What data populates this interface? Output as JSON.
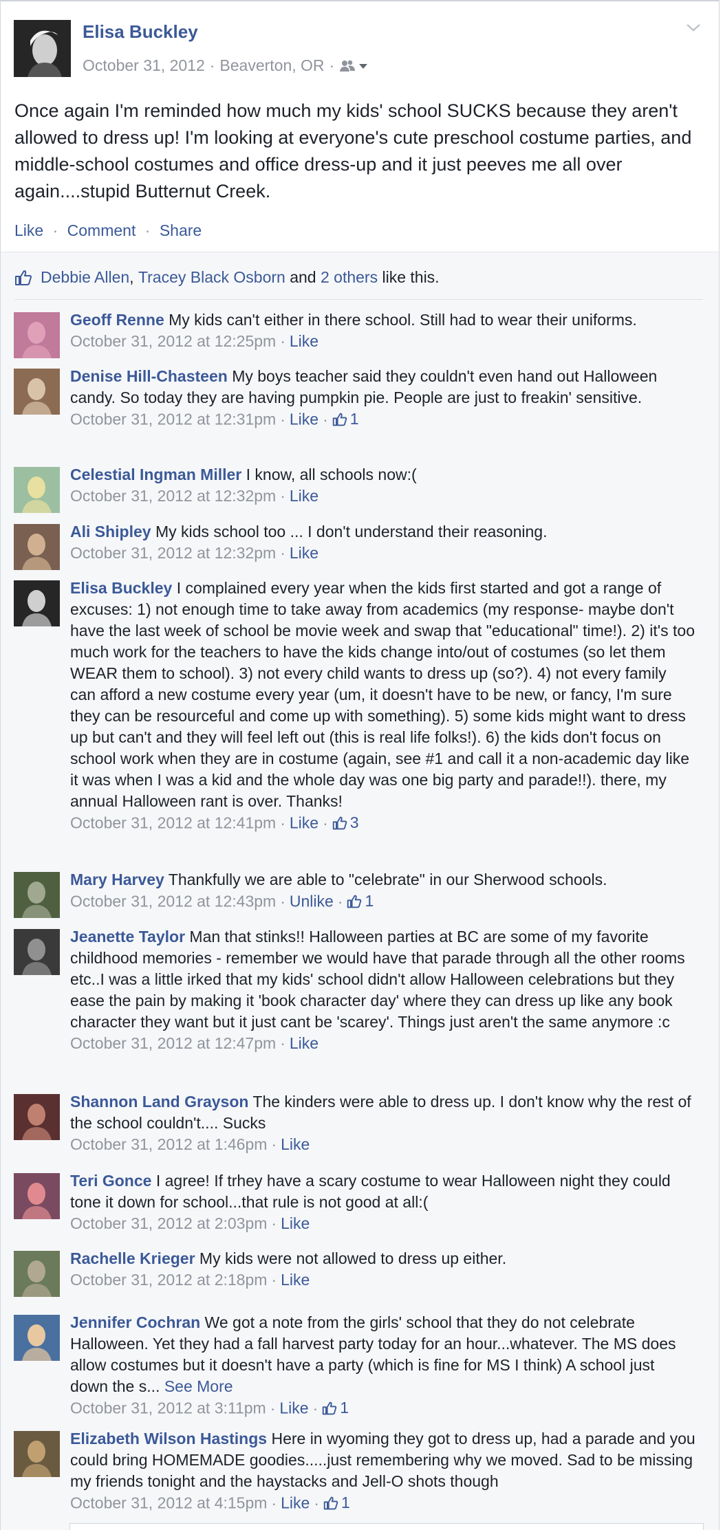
{
  "post": {
    "author": "Elisa Buckley",
    "date": "October 31, 2012",
    "location": "Beaverton, OR",
    "text": "Once again I'm reminded how much my kids' school SUCKS because they aren't allowed to dress up! I'm looking at everyone's cute preschool costume parties, and middle-school costumes and office dress-up and it just peeves me all over again....stupid Butternut Creek.",
    "actions": {
      "like": "Like",
      "comment": "Comment",
      "share": "Share"
    },
    "audience_icon": "friends-icon"
  },
  "likes": {
    "name1": "Debbie Allen",
    "name2": "Tracey Black Osborn",
    "and": "and",
    "others": "2 others",
    "suffix": "like this."
  },
  "comments": [
    {
      "name": "Geoff Renne",
      "text": "My kids can't either in there school. Still had to wear their uniforms.",
      "time": "October 31, 2012 at 12:25pm",
      "action": "Like",
      "likes": ""
    },
    {
      "name": "Denise Hill-Chasteen",
      "text": "My boys teacher said they couldn't even hand out Halloween candy. So today they are having pumpkin pie. People are just to freakin' sensitive.",
      "time": "October 31, 2012 at 12:31pm",
      "action": "Like",
      "likes": "1"
    },
    {
      "name": "Celestial Ingman Miller",
      "text": "I know, all schools now:(",
      "time": "October 31, 2012 at 12:32pm",
      "action": "Like",
      "likes": ""
    },
    {
      "name": "Ali Shipley",
      "text": "My kids school too ... I don't understand their reasoning.",
      "time": "October 31, 2012 at 12:32pm",
      "action": "Like",
      "likes": ""
    },
    {
      "name": "Elisa Buckley",
      "text": "I complained every year when the kids first started and got a range of excuses: 1) not enough time to take away from academics (my response- maybe don't have the last week of school be movie week and swap that \"educational\" time!). 2) it's too much work for the teachers to have the kids change into/out of costumes (so let them WEAR them to school). 3) not every child wants to dress up (so?). 4) not every family can afford a new costume every year (um, it doesn't have to be new, or fancy, I'm sure they can be resourceful and come up with something). 5) some kids might want to dress up but can't and they will feel left out (this is real life folks!). 6) the kids don't focus on school work when they are in costume (again, see #1 and call it a non-academic day like it was when I was a kid and the whole day was one big party and parade!!). there, my annual Halloween rant is over. Thanks!",
      "time": "October 31, 2012 at 12:41pm",
      "action": "Like",
      "likes": "3"
    },
    {
      "name": "Mary Harvey",
      "text": "Thankfully we are able to \"celebrate\" in our Sherwood schools.",
      "time": "October 31, 2012 at 12:43pm",
      "action": "Unlike",
      "likes": "1"
    },
    {
      "name": "Jeanette Taylor",
      "text": "Man that stinks!! Halloween parties at BC are some of my favorite childhood memories - remember we would have that parade through all the other rooms etc..I was a little irked that my kids' school didn't allow Halloween celebrations but they ease the pain by making it 'book character day' where they can dress up like any book character they want but it just cant be 'scarey'. Things just aren't the same anymore :c",
      "time": "October 31, 2012 at 12:47pm",
      "action": "Like",
      "likes": ""
    },
    {
      "name": "Shannon Land Grayson",
      "text": "The kinders were able to dress up. I don't know why the rest of the school couldn't.... Sucks",
      "time": "October 31, 2012 at 1:46pm",
      "action": "Like",
      "likes": ""
    },
    {
      "name": "Teri Gonce",
      "text": "I agree! If trhey have a scary costume to wear Halloween night they could tone it down for school...that rule is not good at all:(",
      "time": "October 31, 2012 at 2:03pm",
      "action": "Like",
      "likes": ""
    },
    {
      "name": "Rachelle Krieger",
      "text": "My kids were not allowed to dress up either.",
      "time": "October 31, 2012 at 2:18pm",
      "action": "Like",
      "likes": ""
    },
    {
      "name": "Jennifer Cochran",
      "text": "We got a note from the girls' school that they do not celebrate Halloween. Yet they had a fall harvest party today for an hour...whatever. The MS does allow costumes but it doesn't have a party (which is fine for MS I think) A school just down the s...",
      "see_more": "See More",
      "time": "October 31, 2012 at 3:11pm",
      "action": "Like",
      "likes": "1"
    },
    {
      "name": "Elizabeth Wilson Hastings",
      "text": "Here in wyoming they got to dress up, had a parade and you could bring HOMEMADE goodies.....just remembering why we moved. Sad to be missing my friends tonight and the haystacks and Jell-O shots though",
      "time": "October 31, 2012 at 4:15pm",
      "action": "Like",
      "likes": "1"
    }
  ],
  "colors": {
    "link": "#3b5998",
    "meta": "#90949c",
    "text": "#1d2129",
    "ufi_bg": "#f6f7f9"
  }
}
